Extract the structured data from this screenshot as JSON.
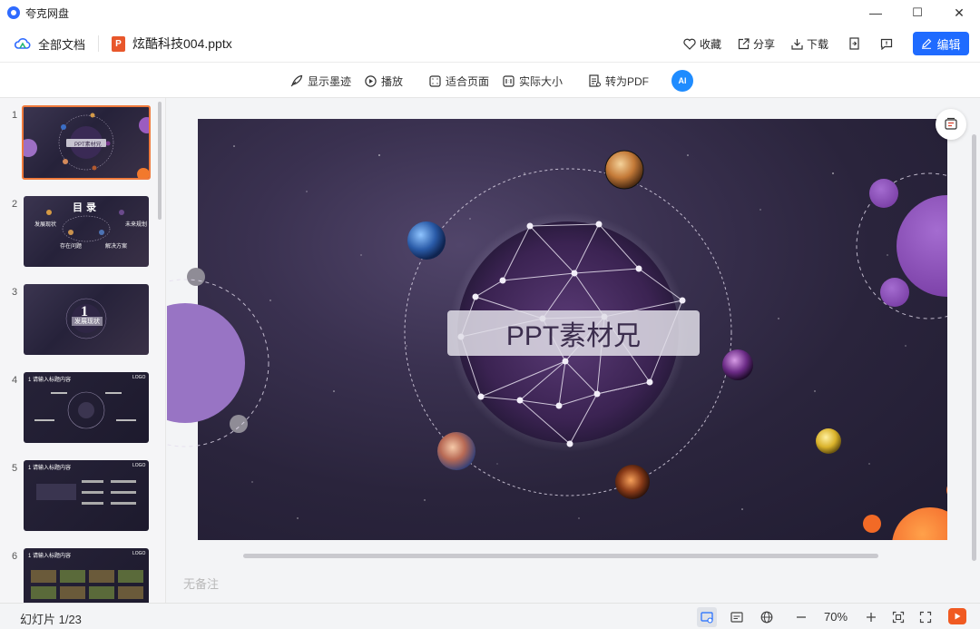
{
  "window": {
    "app_title": "夸克网盘",
    "controls": [
      "—",
      "☐",
      "✕"
    ]
  },
  "header": {
    "all_docs": "全部文档",
    "file_name": "炫酷科技004.pptx",
    "actions": {
      "favorite": "收藏",
      "share": "分享",
      "download": "下载"
    },
    "edit": "编辑"
  },
  "toolbar": {
    "show_ink": "显示墨迹",
    "play": "播放",
    "fit_page": "适合页面",
    "actual_size": "实际大小",
    "to_pdf": "转为PDF",
    "ai": "AI"
  },
  "sidebar": {
    "slides": [
      {
        "num": "1",
        "title": "PPT素材兄"
      },
      {
        "num": "2",
        "title": "目录",
        "items": [
          "发展现状",
          "存在问题",
          "解决方案",
          "未来规划"
        ]
      },
      {
        "num": "3",
        "title": "1",
        "subtitle": "发展现状"
      },
      {
        "num": "4",
        "title": "1 请输入标题内容",
        "logo": "LOGO"
      },
      {
        "num": "5",
        "title": "1 请输入标题内容",
        "logo": "LOGO"
      },
      {
        "num": "6",
        "title": "1 请输入标题内容",
        "logo": "LOGO"
      }
    ]
  },
  "main": {
    "slide_title": "PPT素材兄",
    "notes_placeholder": "无备注"
  },
  "status": {
    "slide_count": "幻灯片 1/23",
    "zoom": "70%"
  },
  "colors": {
    "accent": "#1f6bff",
    "active_thumb": "#f07a3c",
    "play": "#f05a22"
  }
}
